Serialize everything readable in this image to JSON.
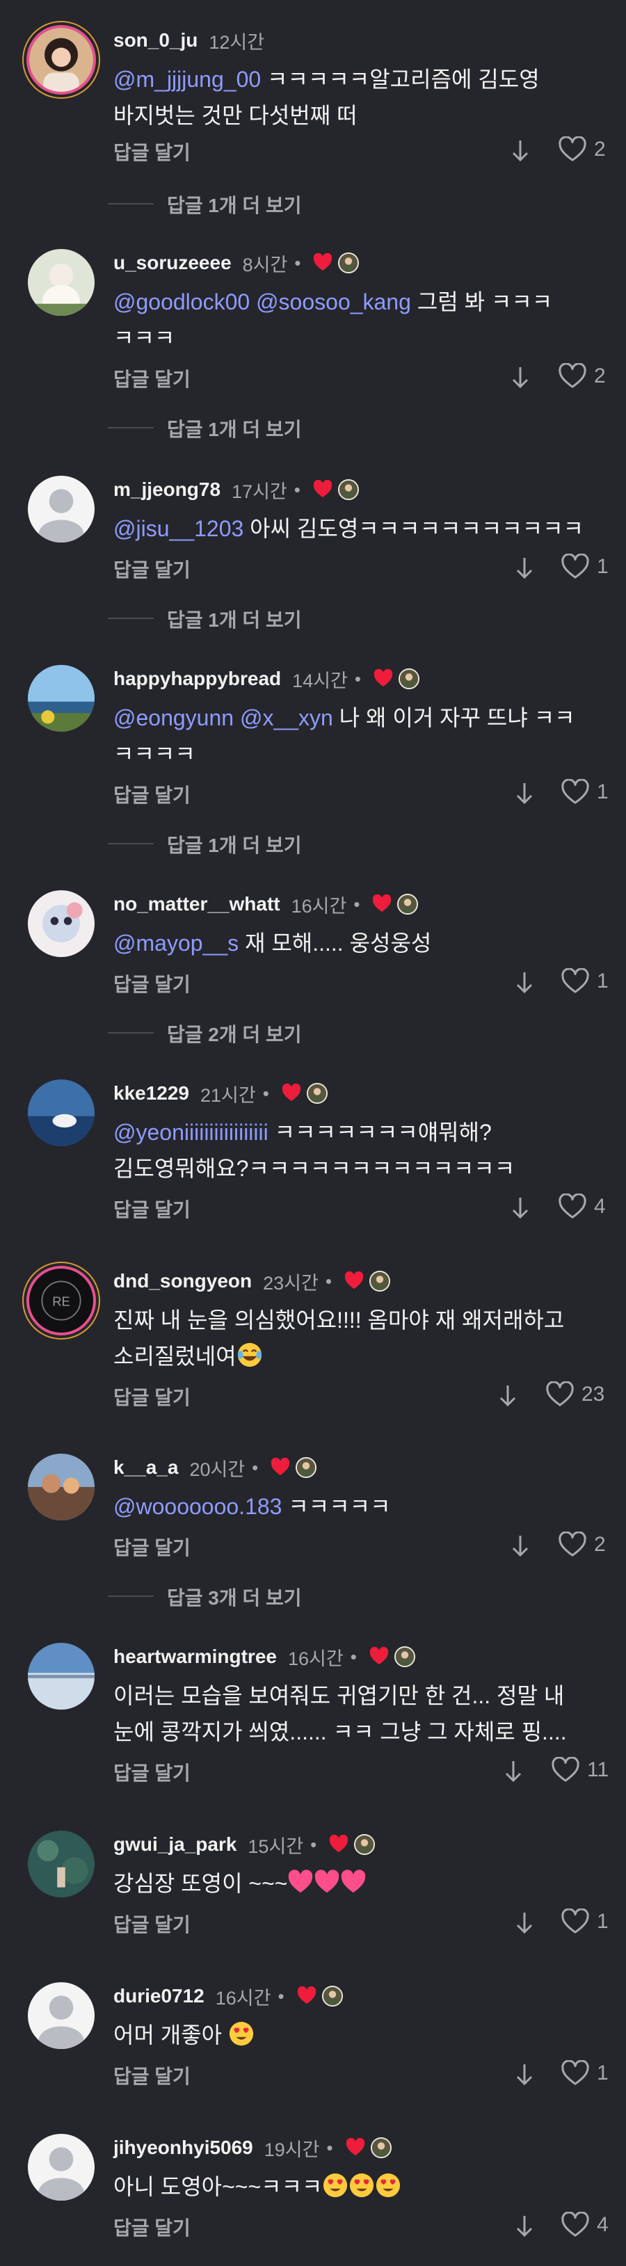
{
  "comments": [
    {
      "user": "son_0_ju",
      "time": "12시간",
      "dot": "",
      "mention": "@m_jjjjung_00",
      "text": " ㅋㅋㅋㅋㅋ알고리즘에 김도영",
      "text2": "바지벗는 것만 다섯번째 떠",
      "reply": "답글 달기",
      "likes": "2",
      "more": "답글 1개 더 보기"
    },
    {
      "user": "u_soruzeeee",
      "time": "8시간",
      "dot": "•",
      "mention": "@goodlock00 @soosoo_kang",
      "text": " 그럼 봐 ㅋㅋㅋ",
      "text2": "ㅋㅋㅋ",
      "reply": "답글 달기",
      "likes": "2",
      "more": "답글 1개 더 보기"
    },
    {
      "user": "m_jjeong78",
      "time": "17시간",
      "dot": "•",
      "mention": "@jisu__1203",
      "text": " 아씨 김도영ㅋㅋㅋㅋㅋㅋㅋㅋㅋㅋㅋ",
      "text2": "",
      "reply": "답글 달기",
      "likes": "1",
      "more": "답글 1개 더 보기"
    },
    {
      "user": "happyhappybread",
      "time": "14시간",
      "dot": "•",
      "mention": "@eongyunn @x__xyn",
      "text": " 나 왜 이거 자꾸 뜨냐 ㅋㅋ",
      "text2": "ㅋㅋㅋㅋ",
      "reply": "답글 달기",
      "likes": "1",
      "more": "답글 1개 더 보기"
    },
    {
      "user": "no_matter__whatt",
      "time": "16시간",
      "dot": "•",
      "mention": "@mayop__s",
      "text": " 재 모해..... 웅성웅성",
      "text2": "",
      "reply": "답글 달기",
      "likes": "1",
      "more": "답글 2개 더 보기"
    },
    {
      "user": "kke1229",
      "time": "21시간",
      "dot": "•",
      "mention": "@yeoniiiiiiiiiiiiiiiii",
      "text": " ㅋㅋㅋㅋㅋㅋㅋ얘뭐해?",
      "text2": "김도영뭐해요?ㅋㅋㅋㅋㅋㅋㅋㅋㅋㅋㅋㅋㅋ",
      "reply": "답글 달기",
      "likes": "4",
      "more": ""
    },
    {
      "user": "dnd_songyeon",
      "time": "23시간",
      "dot": "•",
      "mention": "",
      "text": "진짜 내 눈을 의심했어요!!!! 옴마야 재 왜저래하고",
      "text2": "소리질렀네여",
      "reply": "답글 달기",
      "likes": "23",
      "more": ""
    },
    {
      "user": "k__a_a",
      "time": "20시간",
      "dot": "•",
      "mention": "@wooooooo.183",
      "text": " ㅋㅋㅋㅋㅋ",
      "text2": "",
      "reply": "답글 달기",
      "likes": "2",
      "more": "답글 3개 더 보기"
    },
    {
      "user": "heartwarmingtree",
      "time": "16시간",
      "dot": "•",
      "mention": "",
      "text": "이러는 모습을 보여줘도 귀엽기만 한 건... 정말 내",
      "text2": "눈에 콩깍지가 씌였...... ㅋㅋ 그냥 그 자체로 핑....",
      "reply": "답글 달기",
      "likes": "11",
      "more": ""
    },
    {
      "user": "gwui_ja_park",
      "time": "15시간",
      "dot": "•",
      "mention": "",
      "text": "강심장 또영이 ~~~",
      "text2": "",
      "reply": "답글 달기",
      "likes": "1",
      "more": ""
    },
    {
      "user": "durie0712",
      "time": "16시간",
      "dot": "•",
      "mention": "",
      "text": "어머 개좋아 ",
      "text2": "",
      "reply": "답글 달기",
      "likes": "1",
      "more": ""
    },
    {
      "user": "jihyeonhyi5069",
      "time": "19시간",
      "dot": "•",
      "mention": "",
      "text": "아니 도영아~~~ㅋㅋㅋ",
      "text2": "",
      "reply": "답글 달기",
      "likes": "4",
      "more": ""
    }
  ],
  "icons": {
    "like": "heart-outline-icon",
    "translate": "arrow-down-icon",
    "creator_liked": "red-heart-icon",
    "creator_avatar": "creator-avatar-icon"
  },
  "colors": {
    "background": "#25262b",
    "mention": "#8f9bff",
    "muted": "#a7a8ad",
    "heart": "#ee1d3b"
  }
}
